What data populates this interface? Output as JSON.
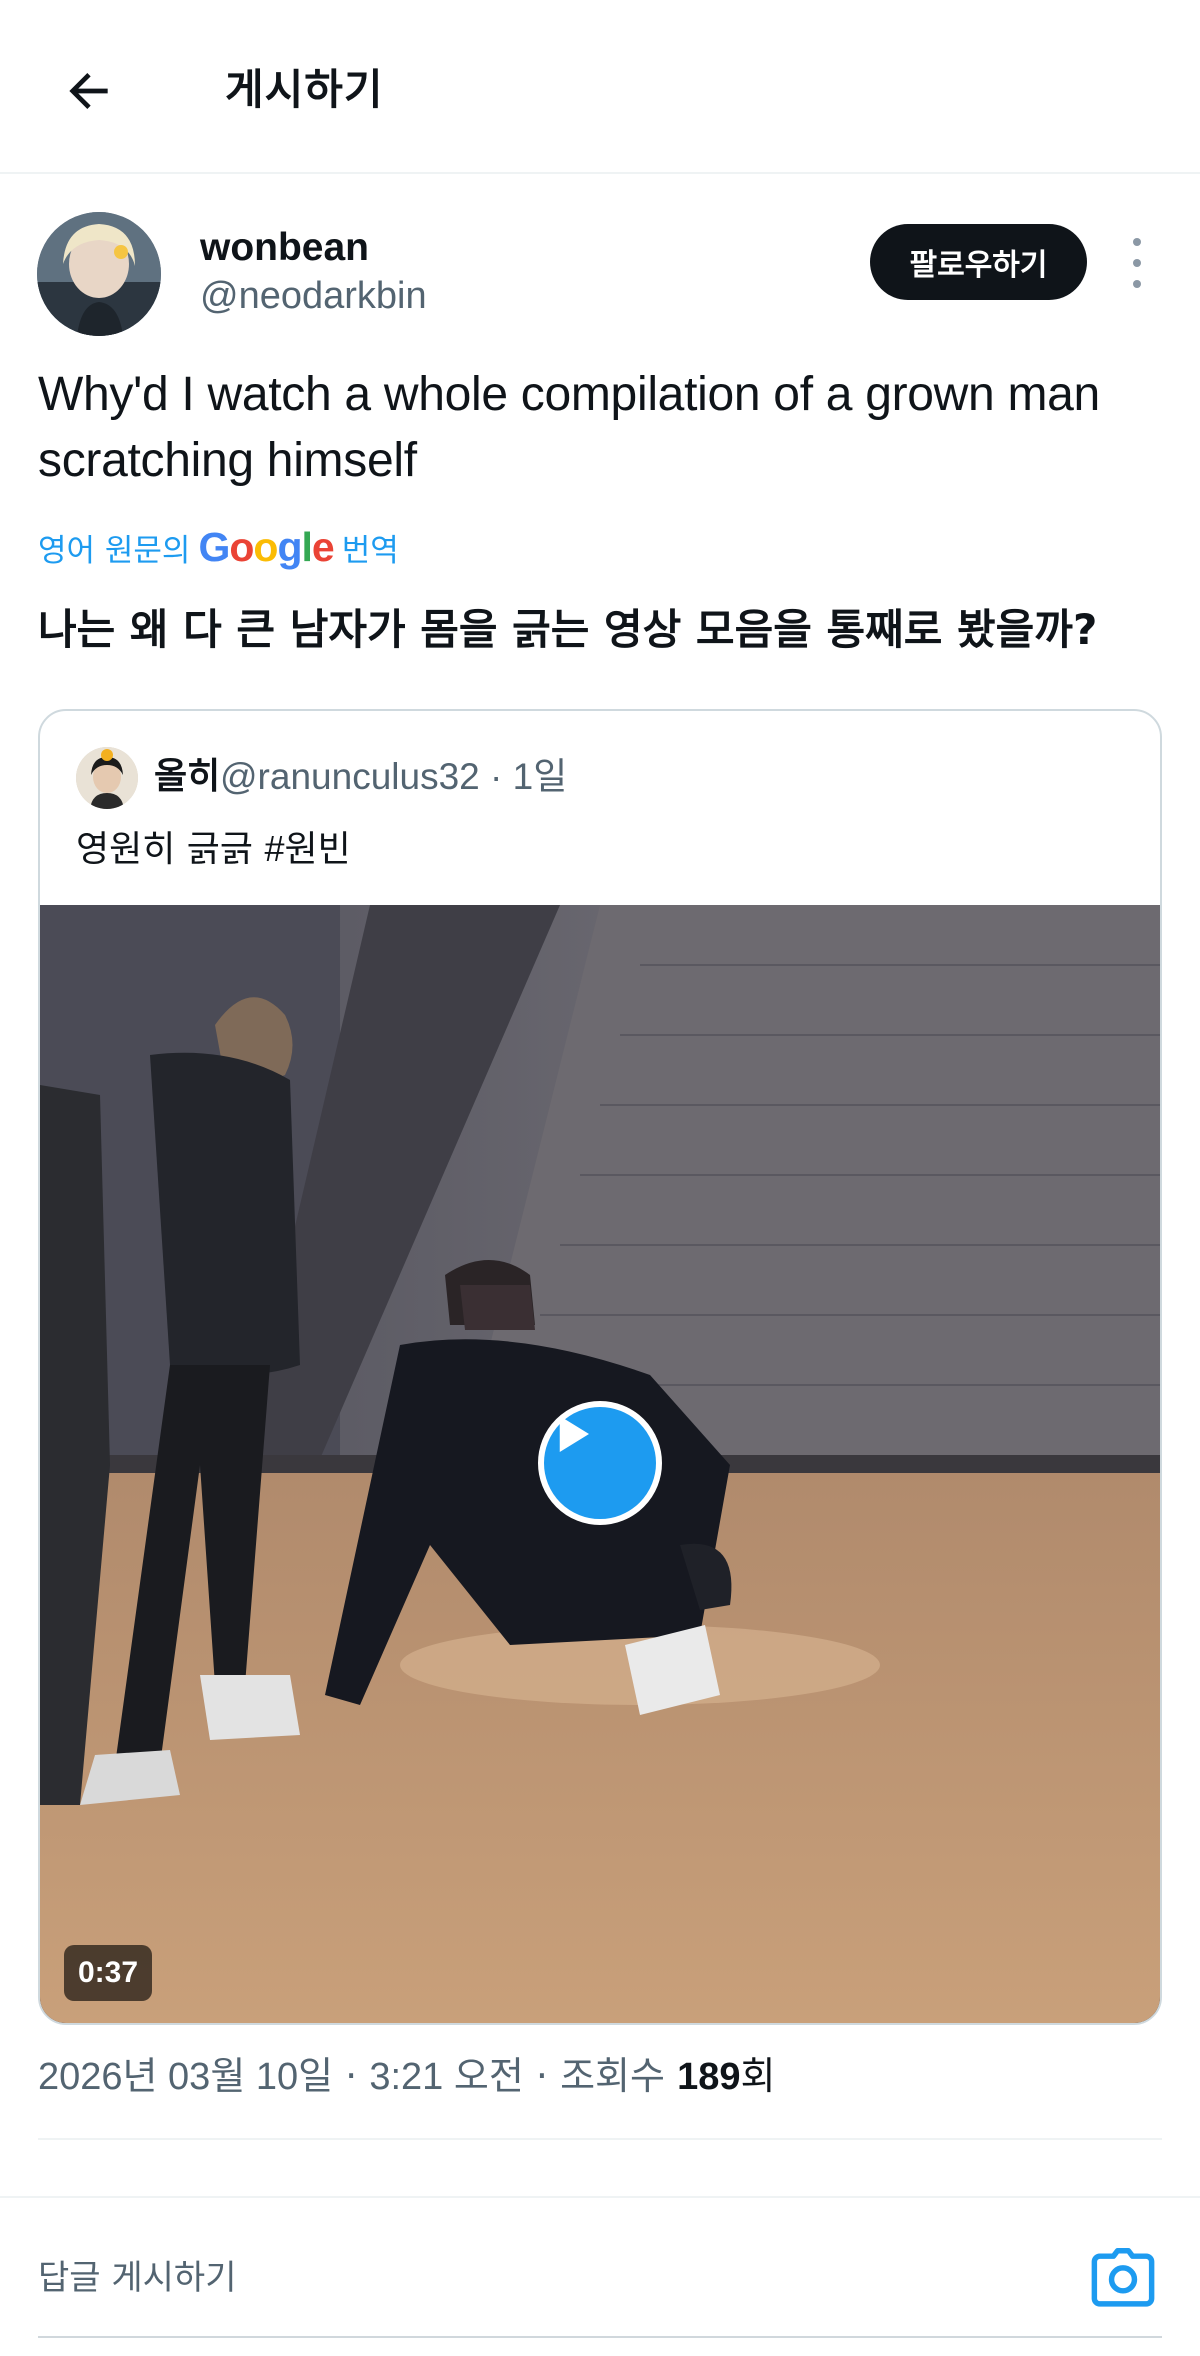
{
  "header": {
    "title": "게시하기",
    "back_icon": "arrow-left-icon"
  },
  "author": {
    "display_name": "wonbean",
    "handle": "@neodarkbin",
    "follow_label": "팔로우하기",
    "more_icon": "more-vertical-icon"
  },
  "tweet": {
    "text": "Why'd I watch a whole compilation of a grown man scratching himself",
    "translate_prefix": "영어 원문의",
    "translate_brand": "Google",
    "translate_suffix": "번역",
    "translated_text": "나는 왜 다 큰 남자가 몸을 긁는 영상 모음을 통째로 봤을까?"
  },
  "quote": {
    "name": "올히",
    "handle": "@ranunculus32",
    "time": "· 1일",
    "text": "영원히 긁긁",
    "hashtag": "#원빈",
    "video": {
      "duration": "0:37",
      "play_icon": "play-icon"
    }
  },
  "meta": {
    "date": "2026년 03월 10일",
    "sep1": "·",
    "time": "3:21 오전",
    "sep2": "·",
    "views_label": "조회수",
    "views_count": "189",
    "views_suffix": "회"
  },
  "reply": {
    "placeholder": "답글 게시하기",
    "camera_icon": "camera-icon"
  },
  "colors": {
    "accent": "#1d9bf0",
    "text": "#0f1419",
    "muted": "#536471",
    "border": "#cfd9de"
  }
}
